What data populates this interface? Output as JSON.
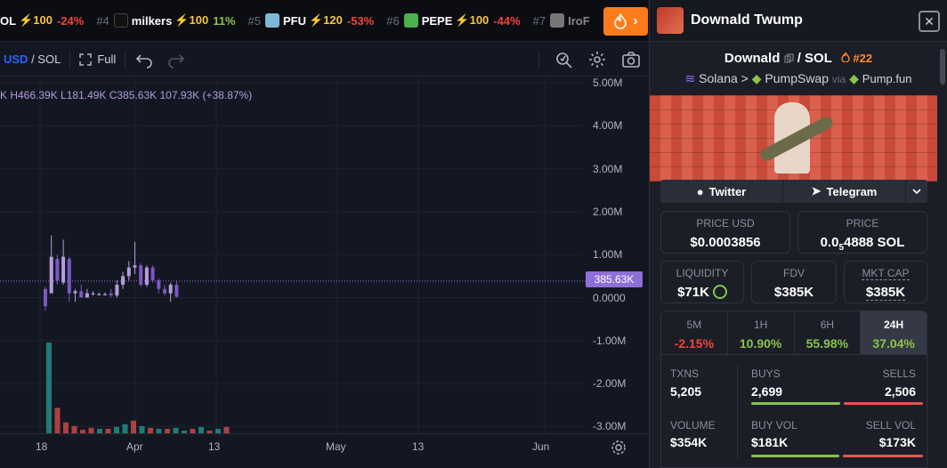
{
  "ticker": {
    "items": [
      {
        "rank": "",
        "symbol": "OL",
        "boost": "⚡100",
        "change": "-24%",
        "dir": "neg"
      },
      {
        "rank": "#4",
        "symbol": "milkers",
        "boost": "⚡100",
        "change": "11%",
        "dir": "pos"
      },
      {
        "rank": "#5",
        "symbol": "PFU",
        "boost": "⚡120",
        "change": "-53%",
        "dir": "neg"
      },
      {
        "rank": "#6",
        "symbol": "PEPE",
        "boost": "⚡100",
        "change": "-44%",
        "dir": "neg"
      },
      {
        "rank": "#7",
        "symbol": "IroF",
        "boost": "",
        "change": "",
        "dir": "neg"
      }
    ],
    "hot_icon": "flame-icon",
    "hot_arrow": "›"
  },
  "toolbar": {
    "quote": "USD",
    "base": "SOL",
    "pair_sep": " / ",
    "full_label": "Full",
    "icons": [
      "undo-icon",
      "redo-icon",
      "measure-icon",
      "settings-icon",
      "camera-icon"
    ]
  },
  "chart": {
    "ohlc_text": "K H466.39K  L181.49K  C385.63K  107.93K (+38.87%)",
    "price_tag": "385.63K",
    "y_labels": [
      "5.00M",
      "4.00M",
      "3.00M",
      "2.00M",
      "1.00M",
      "0.0000",
      "-1.00M",
      "-2.00M",
      "-3.00M"
    ],
    "x_labels": [
      "18",
      "Apr",
      "13",
      "May",
      "13",
      "Jun"
    ]
  },
  "chart_data": {
    "type": "candlestick",
    "x_labels": [
      "18",
      "Apr",
      "13",
      "May",
      "13",
      "Jun"
    ],
    "ylim": [
      -3000000,
      5000000
    ],
    "last_price": "385.63K",
    "candles": [
      {
        "o": 0.2,
        "h": 0.25,
        "l": -0.3,
        "c": -0.2
      },
      {
        "o": 0.1,
        "h": 1.45,
        "l": 0.1,
        "c": 0.95
      },
      {
        "o": 0.9,
        "h": 1.0,
        "l": 0.3,
        "c": 0.4
      },
      {
        "o": 0.35,
        "h": 1.35,
        "l": 0.3,
        "c": 0.95
      },
      {
        "o": 0.9,
        "h": 0.95,
        "l": -0.1,
        "c": 0.1
      },
      {
        "o": 0.1,
        "h": 0.2,
        "l": -0.1,
        "c": 0.15
      },
      {
        "o": 0.15,
        "h": 0.3,
        "l": 0.0,
        "c": 0.0
      },
      {
        "o": 0.0,
        "h": 0.2,
        "l": 0.0,
        "c": 0.1
      },
      {
        "o": 0.1,
        "h": 0.15,
        "l": 0.05,
        "c": 0.1
      },
      {
        "o": 0.08,
        "h": 0.12,
        "l": 0.05,
        "c": 0.08
      },
      {
        "o": 0.08,
        "h": 0.12,
        "l": 0.05,
        "c": 0.08
      },
      {
        "o": 0.1,
        "h": 0.2,
        "l": 0.0,
        "c": 0.05
      },
      {
        "o": 0.05,
        "h": 0.4,
        "l": 0.0,
        "c": 0.3
      },
      {
        "o": 0.3,
        "h": 0.6,
        "l": 0.2,
        "c": 0.5
      },
      {
        "o": 0.5,
        "h": 0.85,
        "l": 0.4,
        "c": 0.7
      },
      {
        "o": 0.7,
        "h": 1.3,
        "l": 0.55,
        "c": 0.75
      },
      {
        "o": 0.75,
        "h": 0.8,
        "l": 0.25,
        "c": 0.3
      },
      {
        "o": 0.3,
        "h": 0.75,
        "l": 0.25,
        "c": 0.7
      },
      {
        "o": 0.7,
        "h": 0.75,
        "l": 0.35,
        "c": 0.4
      },
      {
        "o": 0.4,
        "h": 0.45,
        "l": 0.1,
        "c": 0.2
      },
      {
        "o": 0.2,
        "h": 0.3,
        "l": 0.05,
        "c": 0.1
      },
      {
        "o": 0.1,
        "h": 0.35,
        "l": -0.1,
        "c": 0.3
      },
      {
        "o": 0.3,
        "h": 0.4,
        "l": 0.0,
        "c": 0.02
      }
    ],
    "volume_relative": [
      1.0,
      0.28,
      0.12,
      0.08,
      0.04,
      0.06,
      0.05,
      0.05,
      0.07,
      0.1,
      0.14,
      0.08,
      0.06,
      0.05,
      0.05,
      0.06
    ],
    "volume_colors": [
      "#26a69a",
      "#ef5350",
      "#ef5350",
      "#ef5350",
      "#ef5350",
      "#ef5350",
      "#26a69a",
      "#ef5350",
      "#26a69a",
      "#26a69a",
      "#ef5350",
      "#26a69a",
      "#ef5350",
      "#26a69a",
      "#ef5350",
      "#26a69a"
    ],
    "colors": {
      "up": "#b39ddb",
      "down": "#7e57c2"
    }
  },
  "panel": {
    "title": "Downald Twump",
    "close_label": "✕",
    "pair_base": "Downald",
    "pair_sep": " / ",
    "pair_quote": "SOL",
    "rank": "#22",
    "chain": "Solana",
    "chain_sep": " > ",
    "dex": "PumpSwap",
    "via": "via",
    "launchpad": "Pump.fun",
    "twitter": "Twitter",
    "telegram": "Telegram",
    "price_usd_label": "PRICE USD",
    "price_usd": "$0.0003856",
    "price_label": "PRICE",
    "price_sol_prefix": "0.0",
    "price_sol_sub": "5",
    "price_sol_suffix": "4888 SOL",
    "liquidity_label": "LIQUIDITY",
    "liquidity": "$71K",
    "fdv_label": "FDV",
    "fdv": "$385K",
    "mcap_label": "MKT CAP",
    "mcap": "$385K",
    "timeframes": [
      {
        "label": "5M",
        "value": "-2.15%",
        "dir": "neg"
      },
      {
        "label": "1H",
        "value": "10.90%",
        "dir": "pos"
      },
      {
        "label": "6H",
        "value": "55.98%",
        "dir": "pos"
      },
      {
        "label": "24H",
        "value": "37.04%",
        "dir": "pos",
        "active": true
      }
    ],
    "txns_label": "TXNS",
    "txns": "5,205",
    "buys_label": "BUYS",
    "buys": "2,699",
    "sells_label": "SELLS",
    "sells": "2,506",
    "buy_share": 0.518,
    "volume_label": "VOLUME",
    "volume": "$354K",
    "buy_vol_label": "BUY VOL",
    "buy_vol": "$181K",
    "sell_vol_label": "SELL VOL",
    "sell_vol": "$173K",
    "buy_vol_share": 0.511
  },
  "colors": {
    "accent": "#ff7a1a",
    "up": "#8bc34a",
    "down": "#f44336",
    "candle": "#b39ddb"
  }
}
